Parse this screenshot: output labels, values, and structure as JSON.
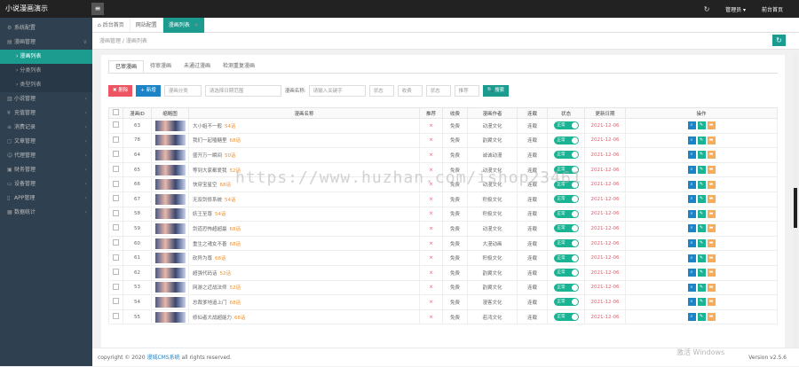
{
  "app": {
    "brand": "小说漫画演示",
    "menu_icon": "≡"
  },
  "top_right": {
    "refresh_icon": "↻",
    "user_label": "管理员 ▾",
    "home_label": "前台首页"
  },
  "sidebar": {
    "items": [
      {
        "label": "系统配置"
      },
      {
        "label": "漫画管理"
      },
      {
        "label": "漫画列表",
        "sub": true,
        "active": true
      },
      {
        "label": "分类列表",
        "sub": true
      },
      {
        "label": "类型列表",
        "sub": true
      },
      {
        "label": "小说管理"
      },
      {
        "label": "充值管理"
      },
      {
        "label": "消费记录"
      },
      {
        "label": "文章管理"
      },
      {
        "label": "代理管理"
      },
      {
        "label": "财务管理"
      },
      {
        "label": "设备管理"
      },
      {
        "label": "APP管理"
      },
      {
        "label": "数据统计"
      }
    ]
  },
  "tabs": [
    {
      "label": "后台首页",
      "active": false
    },
    {
      "label": "网站配置",
      "active": false
    },
    {
      "label": "漫画列表",
      "active": true
    }
  ],
  "breadcrumb": "漫画管理 / 漫画列表",
  "subtabs": [
    "已审漫画",
    "待审漫画",
    "未通过漫画",
    "检测重复漫画"
  ],
  "toolbar": {
    "delete_label": "✖ 删除",
    "add_label": "+ 新增",
    "category_placeholder": "漫画分类",
    "date_placeholder": "请选择日期范围",
    "name_label": "漫画名称:",
    "keyword_placeholder": "请输入关键字",
    "status_placeholder": "状态",
    "fee_placeholder": "收费",
    "state_placeholder": "状态",
    "recommend_placeholder": "推荐",
    "search_label": "🔍 搜索"
  },
  "table": {
    "headers": [
      "漫画ID",
      "缩略图",
      "漫画名称",
      "推荐",
      "收费",
      "漫画作者",
      "连载",
      "状态",
      "更新日期",
      "操作"
    ],
    "rows": [
      {
        "id": "63",
        "name": "大小姐不一般",
        "eps": "54话",
        "fee": "免费",
        "author": "动漫文化",
        "serial": "连载",
        "status": "正常",
        "date": "2021-12-06"
      },
      {
        "id": "78",
        "name": "我们一起嗑糖里",
        "eps": "68话",
        "fee": "免费",
        "author": "韵翼文化",
        "serial": "连载",
        "status": "正常",
        "date": "2021-12-06"
      },
      {
        "id": "64",
        "name": "盛开万一瞬间",
        "eps": "50话",
        "fee": "免费",
        "author": "诚诚动漫",
        "serial": "连载",
        "status": "正常",
        "date": "2021-12-06"
      },
      {
        "id": "65",
        "name": "等到大家都爱我",
        "eps": "52话",
        "fee": "免费",
        "author": "动漫文化",
        "serial": "连载",
        "status": "正常",
        "date": "2021-12-06"
      },
      {
        "id": "66",
        "name": "快穿宝星空",
        "eps": "68话",
        "fee": "免费",
        "author": "动漫文化",
        "serial": "连载",
        "status": "正常",
        "date": "2021-12-06"
      },
      {
        "id": "67",
        "name": "无双剑修系统",
        "eps": "54话",
        "fee": "免费",
        "author": "积极文化",
        "serial": "连载",
        "status": "正常",
        "date": "2021-12-06"
      },
      {
        "id": "58",
        "name": "妖王至尊",
        "eps": "54话",
        "fee": "免费",
        "author": "积极文化",
        "serial": "连载",
        "status": "正常",
        "date": "2021-12-06"
      },
      {
        "id": "59",
        "name": "剑道恐怖超超最",
        "eps": "68话",
        "fee": "免费",
        "author": "动漫文化",
        "serial": "连载",
        "status": "正常",
        "date": "2021-12-06"
      },
      {
        "id": "60",
        "name": "重生之魂女不善",
        "eps": "68话",
        "fee": "免费",
        "author": "大漫动画",
        "serial": "连载",
        "status": "正常",
        "date": "2021-12-06"
      },
      {
        "id": "61",
        "name": "砍异为尊",
        "eps": "68话",
        "fee": "免费",
        "author": "积极文化",
        "serial": "连载",
        "status": "正常",
        "date": "2021-12-06"
      },
      {
        "id": "62",
        "name": "超强代码话",
        "eps": "52话",
        "fee": "免费",
        "author": "韵翼文化",
        "serial": "连载",
        "status": "正常",
        "date": "2021-12-06"
      },
      {
        "id": "53",
        "name": "网游之近战法师",
        "eps": "52话",
        "fee": "免费",
        "author": "韵翼文化",
        "serial": "连载",
        "status": "正常",
        "date": "2021-12-06"
      },
      {
        "id": "54",
        "name": "总裁爹地追上门",
        "eps": "68话",
        "fee": "免费",
        "author": "漫客文化",
        "serial": "连载",
        "status": "正常",
        "date": "2021-12-06"
      },
      {
        "id": "55",
        "name": "修仙者大战超能力",
        "eps": "68话",
        "fee": "免费",
        "author": "若鸿文化",
        "serial": "连载",
        "status": "正常",
        "date": "2021-12-06"
      }
    ]
  },
  "footer": {
    "copyright": "copyright © 2020",
    "link": "漫城CMS系统",
    "rights": "all rights reserved.",
    "version": "Version v2.5.6"
  },
  "overlay": {
    "watermark": "https://www.huzhan.com/ishop23461",
    "activate": "激活 Windows"
  },
  "colors": {
    "accent": "#1c9b8f",
    "danger": "#ed5565",
    "primary": "#1c84c6",
    "sidebar": "#2f4050"
  }
}
